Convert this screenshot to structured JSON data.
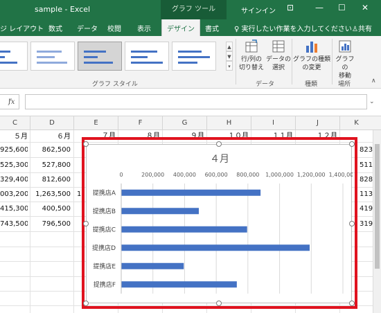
{
  "window": {
    "doc_title": "sample  -  Excel",
    "context_tab": "グラフ ツール",
    "signin": "サインイン",
    "controls": [
      "⊡",
      "—",
      "☐",
      "✕"
    ]
  },
  "tabs": [
    {
      "label": "ジ レイアウト",
      "active": false
    },
    {
      "label": "数式",
      "active": false
    },
    {
      "label": "データ",
      "active": false
    },
    {
      "label": "校閲",
      "active": false
    },
    {
      "label": "表示",
      "active": false
    },
    {
      "label": "デザイン",
      "active": true
    },
    {
      "label": "書式",
      "active": false
    }
  ],
  "tell_me": "実行したい作業を入力してください",
  "share": "共有",
  "ribbon": {
    "group_chart_styles": "グラフ スタイル",
    "btn_switch": [
      "行/列の",
      "切り替え"
    ],
    "btn_select_data": [
      "データの",
      "選択"
    ],
    "group_data": "データ",
    "btn_change_type": [
      "グラフの種類",
      "の変更"
    ],
    "group_type": "種類",
    "btn_move": [
      "グラフの",
      "移動"
    ],
    "group_location": "場所"
  },
  "formula": {
    "fx": "fx",
    "value": ""
  },
  "columns": [
    "C",
    "D",
    "E",
    "F",
    "G",
    "H",
    "I",
    "J",
    "K"
  ],
  "month_headers": [
    "５月",
    "６月",
    "７月",
    "８月",
    "９月",
    "１０月",
    "１１月",
    "１２月"
  ],
  "rows": [
    {
      "c": "925,600",
      "d": "862,500",
      "k": "823,"
    },
    {
      "c": "525,300",
      "d": "527,800",
      "k": "511,"
    },
    {
      "c": "329,400",
      "d": "812,600",
      "k": "828,"
    },
    {
      "c": "003,200",
      "d": "1,263,500",
      "e": "1",
      "k": "113,"
    },
    {
      "c": "415,300",
      "d": "400,500",
      "k": "419,"
    },
    {
      "c": "743,500",
      "d": "796,500",
      "k": "319,"
    }
  ],
  "chart_data": {
    "type": "bar",
    "orientation": "horizontal",
    "title": "４月",
    "categories": [
      "提携店A",
      "提携店B",
      "提携店C",
      "提携店D",
      "提携店E",
      "提携店F"
    ],
    "values": [
      880000,
      490000,
      795000,
      1190000,
      395000,
      730000
    ],
    "xlim": [
      0,
      1400000
    ],
    "x_ticks": [
      "0",
      "200,000",
      "400,000",
      "600,000",
      "800,000",
      "1,000,000",
      "1,200,000",
      "1,400,000"
    ],
    "x_axis_position": "top",
    "grid": true,
    "legend": "none",
    "bar_color": "#4472c4",
    "highlight_color": "#e0131f"
  }
}
